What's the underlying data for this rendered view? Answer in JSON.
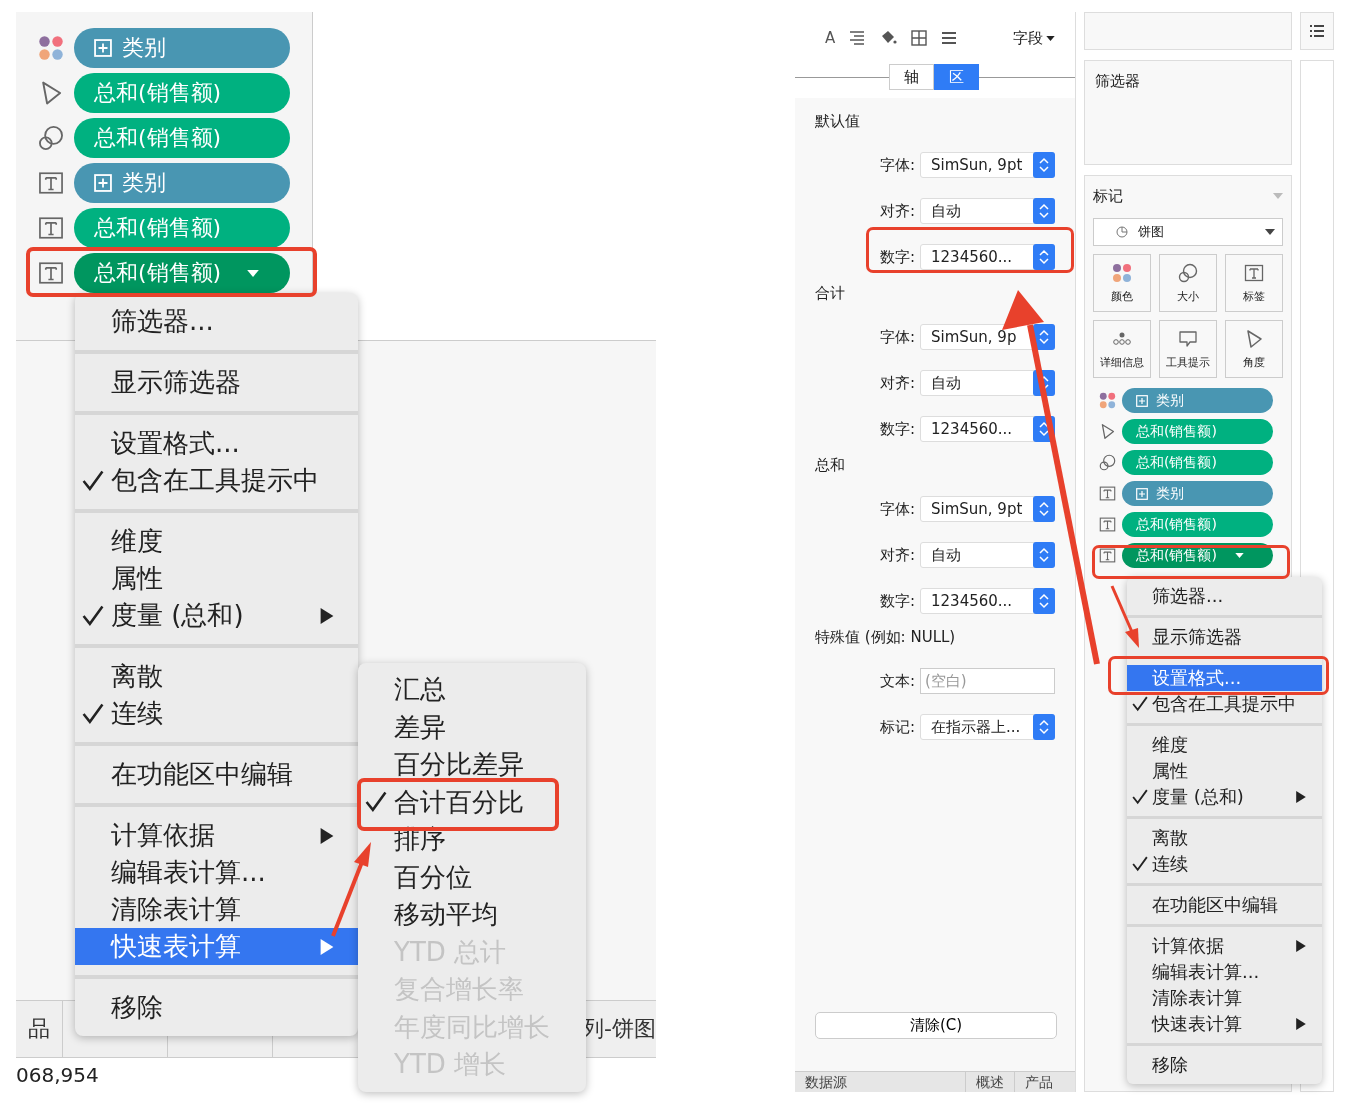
{
  "left": {
    "shelf": [
      {
        "kind": "color",
        "discrete": true,
        "label": "类别",
        "active": false
      },
      {
        "kind": "angle",
        "discrete": false,
        "label": "总和(销售额)",
        "active": false
      },
      {
        "kind": "size",
        "discrete": false,
        "label": "总和(销售额)",
        "active": false
      },
      {
        "kind": "label",
        "discrete": true,
        "label": "类别",
        "active": false
      },
      {
        "kind": "label",
        "discrete": false,
        "label": "总和(销售额)",
        "active": false
      },
      {
        "kind": "label",
        "discrete": false,
        "label": "总和(销售额)",
        "active": true
      }
    ],
    "context_menu": [
      [
        {
          "label": "筛选器...",
          "checked": false,
          "submenu": false,
          "highlighted": false
        }
      ],
      [
        {
          "label": "显示筛选器",
          "checked": false,
          "submenu": false,
          "highlighted": false
        }
      ],
      [
        {
          "label": "设置格式...",
          "checked": false,
          "submenu": false,
          "highlighted": false
        },
        {
          "label": "包含在工具提示中",
          "checked": true,
          "submenu": false,
          "highlighted": false
        }
      ],
      [
        {
          "label": "维度",
          "checked": false,
          "submenu": false,
          "highlighted": false
        },
        {
          "label": "属性",
          "checked": false,
          "submenu": false,
          "highlighted": false
        },
        {
          "label": "度量 (总和)",
          "checked": true,
          "submenu": true,
          "highlighted": false
        }
      ],
      [
        {
          "label": "离散",
          "checked": false,
          "submenu": false,
          "highlighted": false
        },
        {
          "label": "连续",
          "checked": true,
          "submenu": false,
          "highlighted": false
        }
      ],
      [
        {
          "label": "在功能区中编辑",
          "checked": false,
          "submenu": false,
          "highlighted": false
        }
      ],
      [
        {
          "label": "计算依据",
          "checked": false,
          "submenu": true,
          "highlighted": false
        },
        {
          "label": "编辑表计算...",
          "checked": false,
          "submenu": false,
          "highlighted": false
        },
        {
          "label": "清除表计算",
          "checked": false,
          "submenu": false,
          "highlighted": false
        },
        {
          "label": "快速表计算",
          "checked": false,
          "submenu": true,
          "highlighted": true
        }
      ],
      [
        {
          "label": "移除",
          "checked": false,
          "submenu": false,
          "highlighted": false
        }
      ]
    ],
    "submenu": [
      {
        "label": "汇总",
        "checked": false,
        "disabled": false
      },
      {
        "label": "差异",
        "checked": false,
        "disabled": false
      },
      {
        "label": "百分比差异",
        "checked": false,
        "disabled": false
      },
      {
        "label": "合计百分比",
        "checked": true,
        "disabled": false
      },
      {
        "label": "排序",
        "checked": false,
        "disabled": false
      },
      {
        "label": "百分位",
        "checked": false,
        "disabled": false
      },
      {
        "label": "移动平均",
        "checked": false,
        "disabled": false
      },
      {
        "label": "YTD 总计",
        "checked": false,
        "disabled": true
      },
      {
        "label": "复合增长率",
        "checked": false,
        "disabled": true
      },
      {
        "label": "年度同比增长",
        "checked": false,
        "disabled": true
      },
      {
        "label": "YTD 增长",
        "checked": false,
        "disabled": true
      }
    ],
    "tab_left": "品",
    "tab_right": "列-饼图",
    "status": "068,954"
  },
  "right": {
    "format_pane": {
      "toolbar_letter": "A",
      "field_menu": "字段",
      "tabs": [
        {
          "label": "轴",
          "selected": false
        },
        {
          "label": "区",
          "selected": true
        }
      ],
      "sections": [
        {
          "title": "默认值",
          "rows": [
            {
              "label": "字体:",
              "kind": "select",
              "value": "SimSun, 9pt"
            },
            {
              "label": "对齐:",
              "kind": "select",
              "value": "自动"
            },
            {
              "label": "数字:",
              "kind": "select",
              "value": "1234560..."
            }
          ]
        },
        {
          "title": "合计",
          "rows": [
            {
              "label": "字体:",
              "kind": "select",
              "value": "SimSun, 9p"
            },
            {
              "label": "对齐:",
              "kind": "select",
              "value": "自动"
            },
            {
              "label": "数字:",
              "kind": "select",
              "value": "1234560..."
            }
          ]
        },
        {
          "title": "总和",
          "rows": [
            {
              "label": "字体:",
              "kind": "select",
              "value": "SimSun, 9pt"
            },
            {
              "label": "对齐:",
              "kind": "select",
              "value": "自动"
            },
            {
              "label": "数字:",
              "kind": "select",
              "value": "1234560..."
            }
          ]
        },
        {
          "title": "特殊值 (例如: NULL)",
          "rows": [
            {
              "label": "文本:",
              "kind": "text",
              "placeholder": "(空白)"
            },
            {
              "label": "标记:",
              "kind": "select",
              "value": "在指示器上..."
            }
          ]
        }
      ],
      "clear_button": "清除(C)"
    },
    "filters_title": "筛选器",
    "marks": {
      "title": "标记",
      "mark_type": "饼图",
      "buttons": [
        {
          "kind": "color",
          "label": "颜色"
        },
        {
          "kind": "size",
          "label": "大小"
        },
        {
          "kind": "label",
          "label": "标签"
        },
        {
          "kind": "detail",
          "label": "详细信息"
        },
        {
          "kind": "tooltip",
          "label": "工具提示"
        },
        {
          "kind": "angle",
          "label": "角度"
        }
      ],
      "shelf": [
        {
          "kind": "color",
          "discrete": true,
          "label": "类别",
          "active": false
        },
        {
          "kind": "angle",
          "discrete": false,
          "label": "总和(销售额)",
          "active": false
        },
        {
          "kind": "size",
          "discrete": false,
          "label": "总和(销售额)",
          "active": false
        },
        {
          "kind": "label",
          "discrete": true,
          "label": "类别",
          "active": false
        },
        {
          "kind": "label",
          "discrete": false,
          "label": "总和(销售额)",
          "active": false
        },
        {
          "kind": "label",
          "discrete": false,
          "label": "总和(销售额)",
          "active": true
        }
      ]
    },
    "context_menu": [
      [
        {
          "label": "筛选器...",
          "checked": false,
          "submenu": false,
          "highlighted": false
        }
      ],
      [
        {
          "label": "显示筛选器",
          "checked": false,
          "submenu": false,
          "highlighted": false
        }
      ],
      [
        {
          "label": "设置格式...",
          "checked": false,
          "submenu": false,
          "highlighted": true
        },
        {
          "label": "包含在工具提示中",
          "checked": true,
          "submenu": false,
          "highlighted": false
        }
      ],
      [
        {
          "label": "维度",
          "checked": false,
          "submenu": false,
          "highlighted": false
        },
        {
          "label": "属性",
          "checked": false,
          "submenu": false,
          "highlighted": false
        },
        {
          "label": "度量 (总和)",
          "checked": true,
          "submenu": true,
          "highlighted": false
        }
      ],
      [
        {
          "label": "离散",
          "checked": false,
          "submenu": false,
          "highlighted": false
        },
        {
          "label": "连续",
          "checked": true,
          "submenu": false,
          "highlighted": false
        }
      ],
      [
        {
          "label": "在功能区中编辑",
          "checked": false,
          "submenu": false,
          "highlighted": false
        }
      ],
      [
        {
          "label": "计算依据",
          "checked": false,
          "submenu": true,
          "highlighted": false
        },
        {
          "label": "编辑表计算...",
          "checked": false,
          "submenu": false,
          "highlighted": false
        },
        {
          "label": "清除表计算",
          "checked": false,
          "submenu": false,
          "highlighted": false
        },
        {
          "label": "快速表计算",
          "checked": false,
          "submenu": true,
          "highlighted": false
        }
      ],
      [
        {
          "label": "移除",
          "checked": false,
          "submenu": false,
          "highlighted": false
        }
      ]
    ],
    "bottom_tabs": [
      "数据源",
      "概述",
      "产品"
    ]
  }
}
